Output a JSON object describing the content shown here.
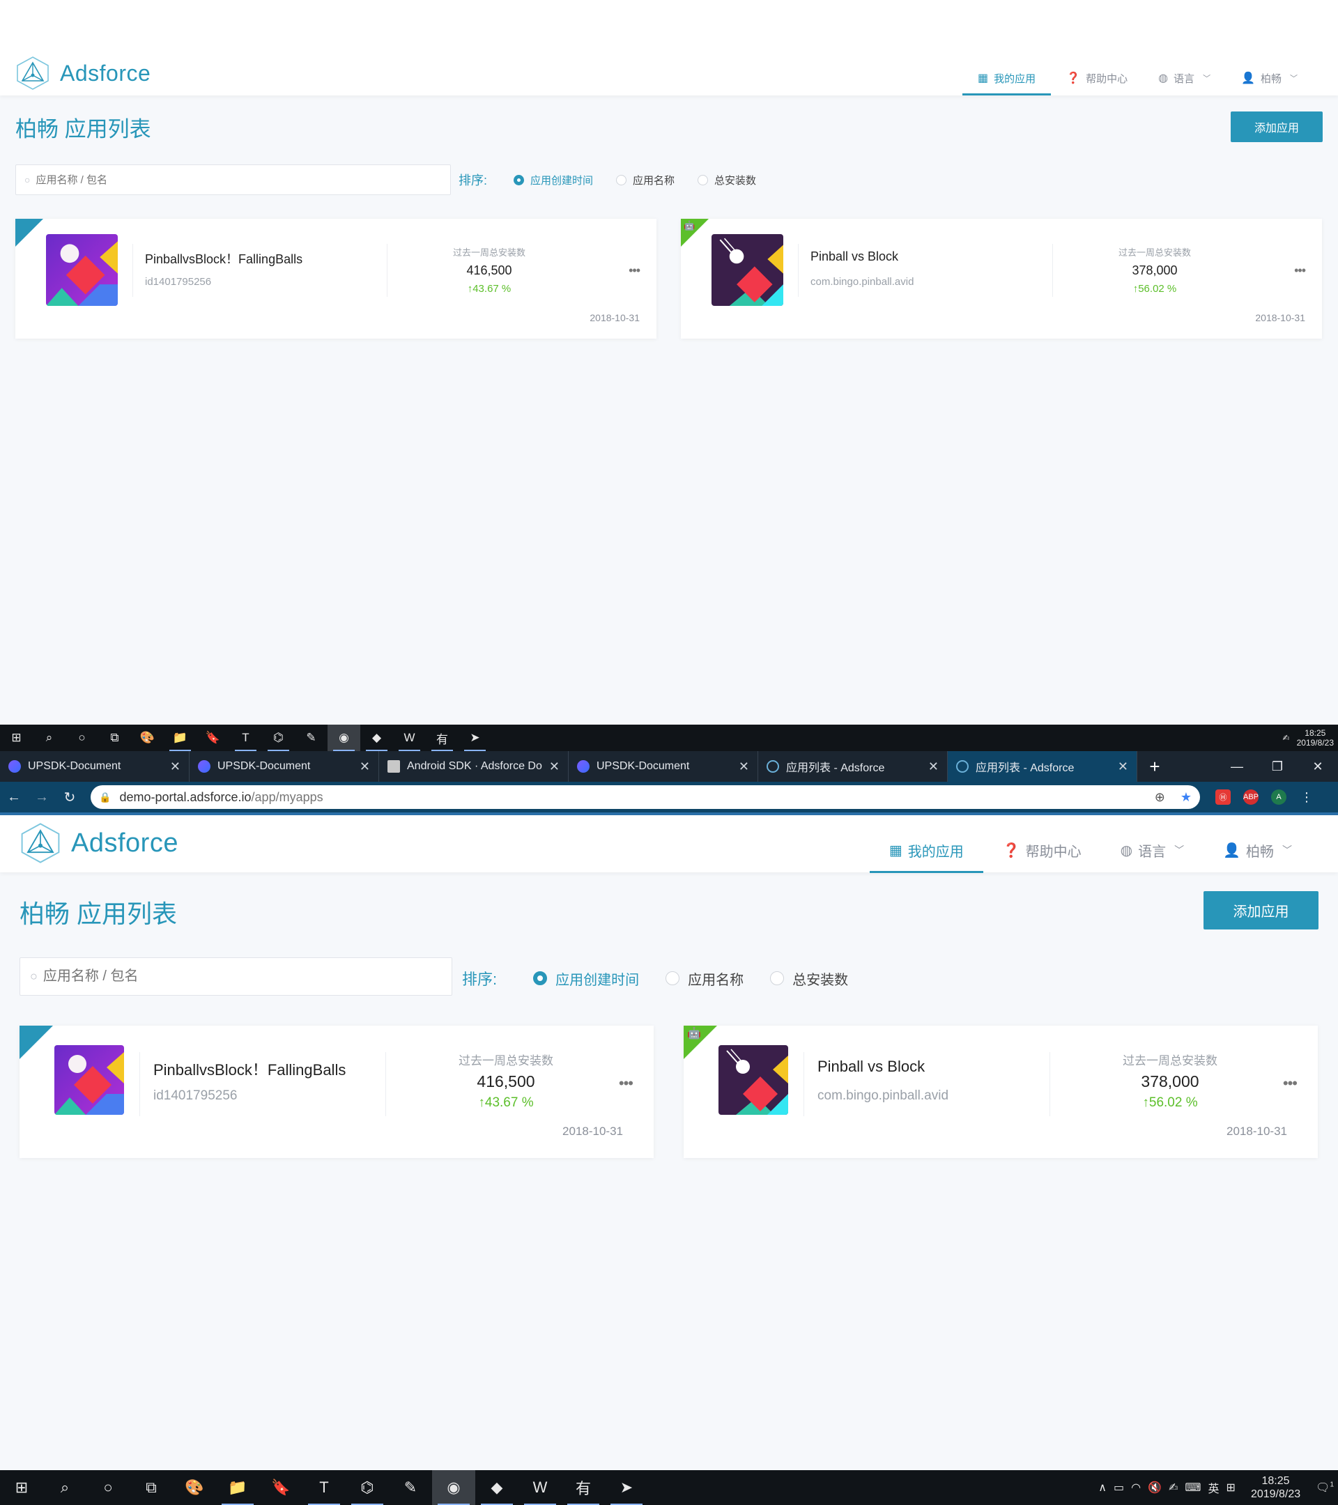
{
  "app": {
    "logo_text": "Adsforce",
    "nav": [
      {
        "label": "我的应用",
        "icon": "grid-icon",
        "active": true
      },
      {
        "label": "帮助中心",
        "icon": "help-icon",
        "active": false
      },
      {
        "label": "语言",
        "icon": "globe-icon",
        "active": false
      },
      {
        "label": "柏畅",
        "icon": "user-icon",
        "active": false
      }
    ],
    "page_title": "柏畅 应用列表",
    "add_button": "添加应用",
    "search_placeholder": "应用名称 / 包名",
    "sort_label": "排序:",
    "sort_options": [
      "应用创建时间",
      "应用名称",
      "总安装数"
    ],
    "sort_selected": 0,
    "apps": [
      {
        "platform": "ios",
        "name": "PinballvsBlock！FallingBalls",
        "id": "id1401795256",
        "stat_label": "过去一周总安装数",
        "installs": "416,500",
        "growth": "43.67 %",
        "date": "2018-10-31"
      },
      {
        "platform": "android",
        "name": "Pinball vs Block",
        "id": "com.bingo.pinball.avid",
        "stat_label": "过去一周总安装数",
        "installs": "378,000",
        "growth": "56.02 %",
        "date": "2018-10-31"
      }
    ]
  },
  "browser": {
    "tabs": [
      {
        "title": "UPSDK-Document",
        "favicon": "upsdk-icon"
      },
      {
        "title": "UPSDK-Document",
        "favicon": "upsdk-icon"
      },
      {
        "title": "Android SDK · Adsforce Do",
        "favicon": "book-icon"
      },
      {
        "title": "UPSDK-Document",
        "favicon": "upsdk-icon"
      },
      {
        "title": "应用列表 - Adsforce",
        "favicon": "adsforce-icon"
      },
      {
        "title": "应用列表 - Adsforce",
        "favicon": "adsforce-icon",
        "active": true
      }
    ],
    "url_host": "demo-portal.adsforce.io",
    "url_path": "/app/myapps"
  },
  "taskbar": {
    "time": "18:25",
    "date": "2019/8/23",
    "ime": "英",
    "notifications": "1"
  },
  "colors": {
    "accent": "#2896b9",
    "ios_corner": "#2896b9",
    "android_corner": "#5cbf2a",
    "growth": "#5cbf2a"
  }
}
